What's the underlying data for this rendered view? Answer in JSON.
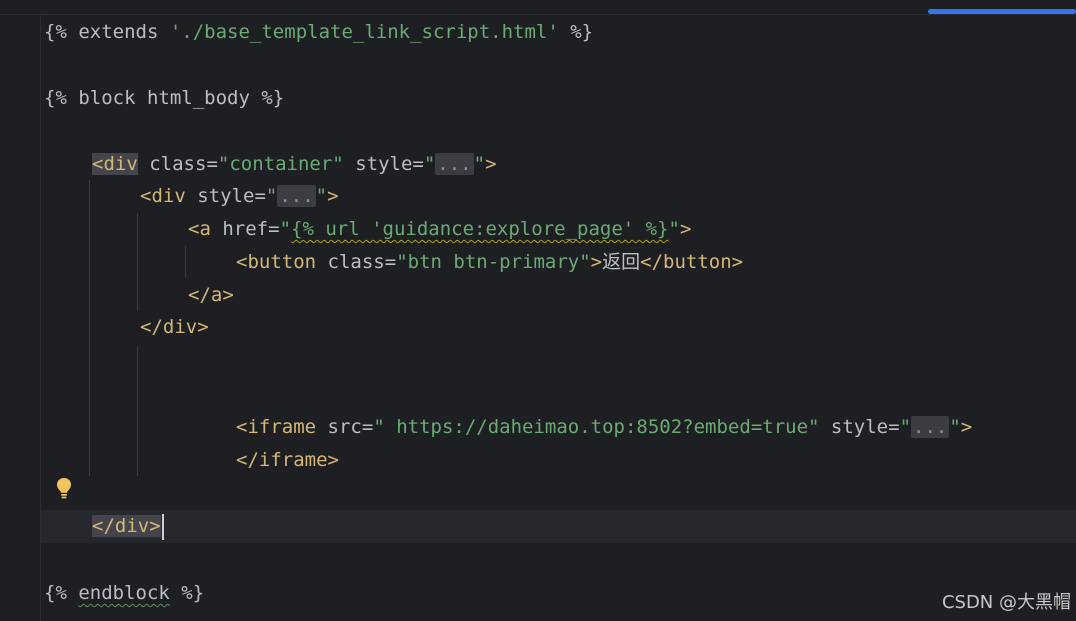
{
  "code": {
    "l1": {
      "open": "{% ",
      "kw": "extends",
      "sp": " ",
      "str": "'./base_template_link_script.html'",
      "close": " %}"
    },
    "l3": {
      "text": "{% block html_body %}"
    },
    "l5": {
      "lt": "<",
      "tag": "div",
      "sp1": " ",
      "attr1": "class",
      "eq1": "=",
      "val1": "\"container\"",
      "sp2": " ",
      "attr2": "style",
      "eq2": "=",
      "q1": "\"",
      "fold": "...",
      "q2": "\"",
      "gt": ">"
    },
    "l6": {
      "lt": "<",
      "tag": "div",
      "sp1": " ",
      "attr1": "style",
      "eq1": "=",
      "q1": "\"",
      "fold": "...",
      "q2": "\"",
      "gt": ">"
    },
    "l7": {
      "lt": "<",
      "tag": "a",
      "sp1": " ",
      "attr1": "href",
      "eq1": "=",
      "q1": "\"",
      "tpl": "{% url 'guidance:explore_page' %}",
      "q2": "\"",
      "gt": ">"
    },
    "l8": {
      "lt": "<",
      "tag": "button",
      "sp1": " ",
      "attr1": "class",
      "eq1": "=",
      "val1": "\"btn btn-primary\"",
      "gt": ">",
      "text": "返回",
      "close": "</button>"
    },
    "l9": {
      "text": "</a>"
    },
    "l10": {
      "text": "</div>"
    },
    "l13": {
      "lt": "<",
      "tag": "iframe",
      "sp1": " ",
      "attr1": "src",
      "eq1": "=",
      "val1": "\" https://daheimao.top:8502?embed=true\"",
      "sp2": " ",
      "attr2": "style",
      "eq2": "=",
      "q1": "\"",
      "fold": "...",
      "q2": "\"",
      "gt": ">"
    },
    "l14": {
      "text": "</iframe>"
    },
    "l16": {
      "text": "</div>"
    },
    "l18": {
      "open": "{% ",
      "kw": "endblock",
      "close": " %}"
    }
  },
  "watermark": "CSDN @大黑帽",
  "colors": {
    "background": "#1e1f22",
    "tag": "#d5b778",
    "string": "#6aab73",
    "text": "#bcbec4",
    "accent": "#3574f0"
  },
  "icons": {
    "intention": "lightbulb-icon"
  }
}
